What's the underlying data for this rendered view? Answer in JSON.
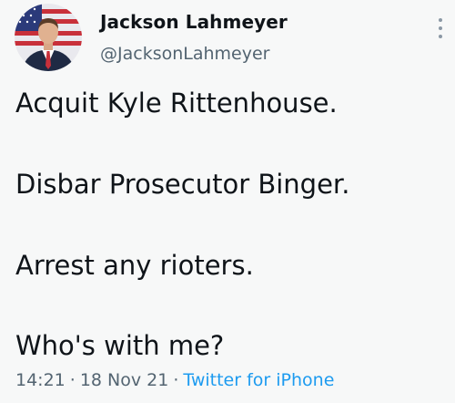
{
  "author": {
    "display_name": "Jackson Lahmeyer",
    "handle": "@JacksonLahmeyer"
  },
  "tweet": {
    "lines": [
      "Acquit Kyle Rittenhouse.",
      "Disbar Prosecutor Binger.",
      "Arrest any rioters.",
      "Who's with me?"
    ]
  },
  "meta": {
    "time": "14:21",
    "date": "18 Nov 21",
    "separator": "·",
    "source": "Twitter for iPhone"
  },
  "icons": {
    "more": "more-vertical-icon",
    "avatar": "profile-photo"
  },
  "colors": {
    "background": "#f7f8f8",
    "text": "#0f1419",
    "secondary": "#536471",
    "link": "#1d9bf0"
  }
}
